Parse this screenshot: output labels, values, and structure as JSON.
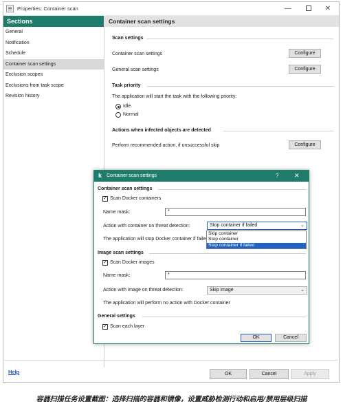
{
  "window": {
    "title": "Properties: Container scan",
    "controls": {
      "minimize": "—",
      "close": "✕"
    }
  },
  "sidebar": {
    "header": "Sections",
    "items": [
      {
        "label": "General"
      },
      {
        "label": "Notification"
      },
      {
        "label": "Schedule"
      },
      {
        "label": "Container scan settings",
        "active": true
      },
      {
        "label": "Exclusion scopes"
      },
      {
        "label": "Exclusions from task scope"
      },
      {
        "label": "Revision history"
      }
    ]
  },
  "main": {
    "header": "Container scan settings",
    "scan_settings": {
      "title": "Scan settings",
      "container_label": "Container scan settings",
      "general_label": "General scan settings",
      "configure": "Configure"
    },
    "task_priority": {
      "title": "Task priority",
      "description": "The application will start the task with the following priority:",
      "options": [
        {
          "label": "Idle",
          "checked": true
        },
        {
          "label": "Normal",
          "checked": false
        }
      ]
    },
    "actions": {
      "title": "Actions when infected objects are detected",
      "label": "Perform recommended action, if unsuccessful skip",
      "configure": "Configure"
    }
  },
  "footer": {
    "help": "Help",
    "ok": "OK",
    "cancel": "Cancel",
    "apply": "Apply"
  },
  "dialog": {
    "logo": "k",
    "title": "Container scan settings",
    "help_icon": "?",
    "close_icon": "✕",
    "container": {
      "title": "Container scan settings",
      "scan_checkbox": "Scan Docker containers",
      "name_mask_label": "Name mask:",
      "name_mask_value": "*",
      "action_label": "Action with container on threat detection:",
      "action_value": "Stop container if failed",
      "description": "The application will stop Docker container if failed",
      "dropdown_options": [
        "Skip container",
        "Stop container",
        "Stop container if failed"
      ],
      "dropdown_selected_index": 2
    },
    "image": {
      "title": "Image scan settings",
      "scan_checkbox": "Scan Docker images",
      "name_mask_label": "Name mask:",
      "name_mask_value": "*",
      "action_label": "Action with image on threat detection:",
      "action_value": "Skip image",
      "description": "The application will perform no action with Docker container"
    },
    "general": {
      "title": "General settings",
      "scan_checkbox": "Scan each layer"
    },
    "ok": "OK",
    "cancel": "Cancel"
  },
  "caption": "容器扫描任务设置截图：选择扫描的容器和镜像，设置威胁检测行动和启用/禁用层级扫描",
  "colors": {
    "accent": "#1f7c6a",
    "selection": "#1f63c6",
    "link": "#1a4fb3"
  }
}
